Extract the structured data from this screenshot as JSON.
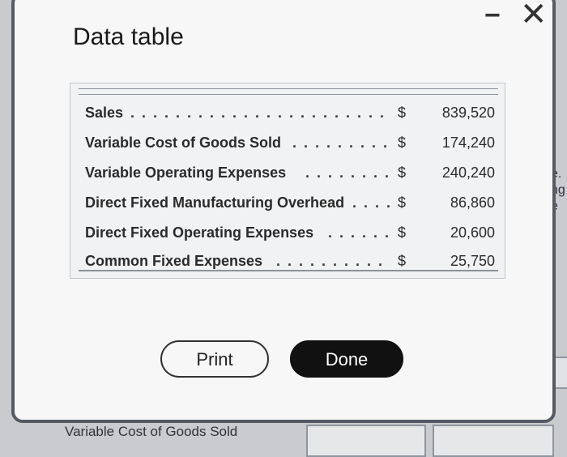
{
  "dialog": {
    "title": "Data table",
    "minimize_glyph": "−",
    "close_glyph": "✕"
  },
  "table": {
    "rows": [
      {
        "label": "Sales",
        "dots": ". . . . . . . . . . . . . . . . . . . . . . . . . . . . . . . . . . . . . .",
        "currency": "$",
        "amount": "839,520"
      },
      {
        "label": "Variable Cost of Goods Sold",
        "dots": ". . . . . . . . . . . . . . . . . . . . . .",
        "currency": "$",
        "amount": "174,240"
      },
      {
        "label": "Variable Operating Expenses",
        "dots": ". . . . . . . . . . . . . . . . . . . . . .",
        "currency": "$",
        "amount": "240,240"
      },
      {
        "label": "Direct Fixed Manufacturing Overhead",
        "dots": ". . . . . . . . . .",
        "currency": "$",
        "amount": "86,860"
      },
      {
        "label": "Direct Fixed Operating Expenses",
        "dots": ". . . . . . . . . . . . . . . .",
        "currency": "$",
        "amount": "20,600"
      },
      {
        "label": "Common Fixed Expenses",
        "dots": ". . . . . . . . . . . . . . . . . . . . . . . . .",
        "currency": "$",
        "amount": "25,750"
      }
    ]
  },
  "buttons": {
    "print": "Print",
    "done": "Done"
  },
  "background": {
    "bottom_label": "Variable Cost of Goods Sold",
    "right_text": "e.\nng\ne"
  }
}
